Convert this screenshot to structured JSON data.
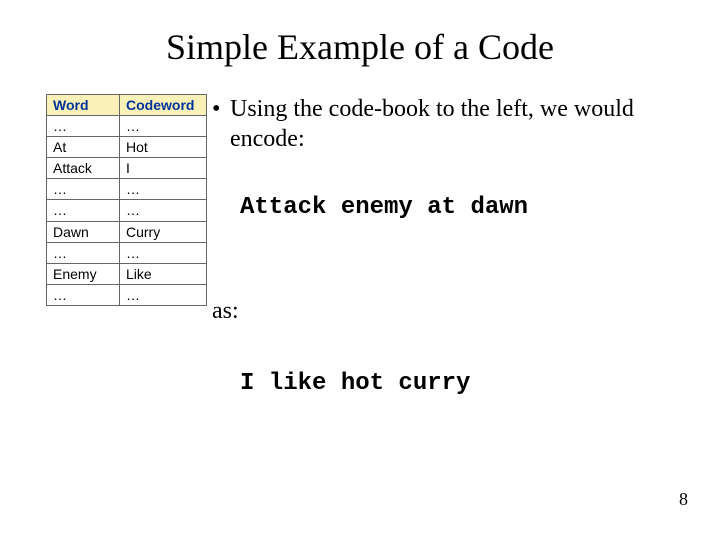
{
  "title": "Simple Example of a Code",
  "codebook": {
    "headers": {
      "word": "Word",
      "codeword": "Codeword"
    },
    "rows": [
      {
        "word": "…",
        "codeword": "…"
      },
      {
        "word": "At",
        "codeword": "Hot"
      },
      {
        "word": "Attack",
        "codeword": "I"
      },
      {
        "word": "…",
        "codeword": "…"
      },
      {
        "word": "…",
        "codeword": "…"
      },
      {
        "word": "Dawn",
        "codeword": "Curry"
      },
      {
        "word": "…",
        "codeword": "…"
      },
      {
        "word": "Enemy",
        "codeword": "Like"
      },
      {
        "word": "…",
        "codeword": "…"
      }
    ]
  },
  "bullet_text": "Using the code-book to the left, we would encode:",
  "plaintext": "Attack enemy at dawn",
  "as_label": "as:",
  "ciphertext": "I like hot curry",
  "page_number": "8"
}
